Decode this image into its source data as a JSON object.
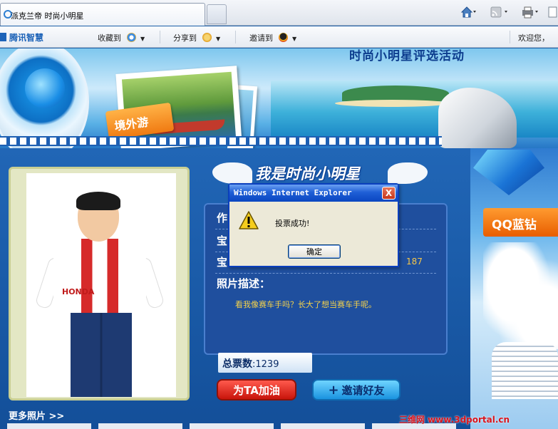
{
  "browser": {
    "tab_title": "派克兰帝 时尚小明星"
  },
  "toolbar": {
    "brand": "腾讯智慧",
    "favorite": "收藏到",
    "share": "分享到",
    "invite": "邀请到",
    "welcome": "欢迎您，"
  },
  "banner": {
    "title": "时尚小明星评选活动",
    "tag": "境外游"
  },
  "content": {
    "heading": "我是时尚小明星",
    "rows": [
      {
        "label": "作"
      },
      {
        "label": "宝"
      },
      {
        "label": "宝",
        "value": "187"
      }
    ],
    "description_label": "照片描述：",
    "description_text": "看我像赛车手吗？长大了想当赛车手呢。",
    "total_votes_label": "总票数",
    "total_votes_value": ":1239",
    "vote_button": "为TA加油",
    "invite_button": "邀请好友",
    "more_photos": "更多照片 >>",
    "jacket_text": "HONDA"
  },
  "sidebar": {
    "qq_blue": "QQ蓝钻"
  },
  "watermark": "三维网 www.3dportal.cn",
  "dialog": {
    "title": "Windows Internet Explorer",
    "message": "投票成功!",
    "ok": "确定",
    "close": "X"
  },
  "colors": {
    "dialog_title": "#0a46c1",
    "vote_button": "#c8140b",
    "invite_button": "#1a93e0",
    "description_text": "#f5d24a"
  }
}
